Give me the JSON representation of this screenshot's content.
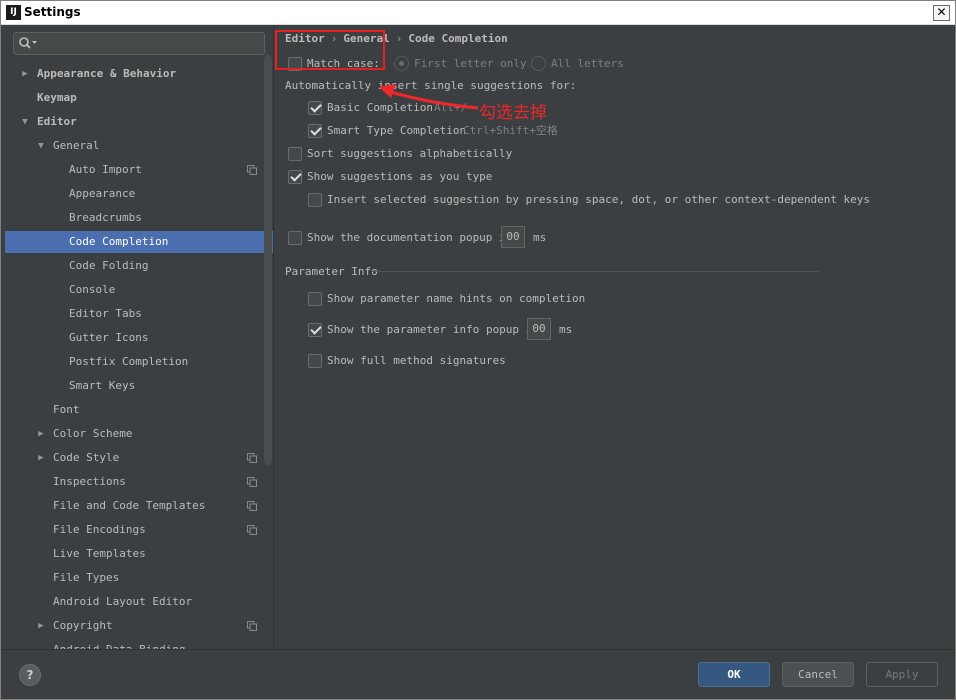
{
  "window": {
    "title": "Settings",
    "app_icon_label": "IJ",
    "close_label": "✕"
  },
  "search": {
    "value": "",
    "placeholder": ""
  },
  "tree": [
    {
      "label": "Appearance & Behavior",
      "level": 0,
      "arrow": "▶",
      "bold": true,
      "selected": false,
      "copy": false
    },
    {
      "label": "Keymap",
      "level": 0,
      "arrow": "",
      "bold": true,
      "selected": false,
      "copy": false
    },
    {
      "label": "Editor",
      "level": 0,
      "arrow": "▼",
      "bold": true,
      "selected": false,
      "copy": false
    },
    {
      "label": "General",
      "level": 1,
      "arrow": "▼",
      "bold": false,
      "selected": false,
      "copy": false
    },
    {
      "label": "Auto Import",
      "level": 2,
      "arrow": "",
      "bold": false,
      "selected": false,
      "copy": true
    },
    {
      "label": "Appearance",
      "level": 2,
      "arrow": "",
      "bold": false,
      "selected": false,
      "copy": false
    },
    {
      "label": "Breadcrumbs",
      "level": 2,
      "arrow": "",
      "bold": false,
      "selected": false,
      "copy": false
    },
    {
      "label": "Code Completion",
      "level": 2,
      "arrow": "",
      "bold": false,
      "selected": true,
      "copy": false
    },
    {
      "label": "Code Folding",
      "level": 2,
      "arrow": "",
      "bold": false,
      "selected": false,
      "copy": false
    },
    {
      "label": "Console",
      "level": 2,
      "arrow": "",
      "bold": false,
      "selected": false,
      "copy": false
    },
    {
      "label": "Editor Tabs",
      "level": 2,
      "arrow": "",
      "bold": false,
      "selected": false,
      "copy": false
    },
    {
      "label": "Gutter Icons",
      "level": 2,
      "arrow": "",
      "bold": false,
      "selected": false,
      "copy": false
    },
    {
      "label": "Postfix Completion",
      "level": 2,
      "arrow": "",
      "bold": false,
      "selected": false,
      "copy": false
    },
    {
      "label": "Smart Keys",
      "level": 2,
      "arrow": "",
      "bold": false,
      "selected": false,
      "copy": false
    },
    {
      "label": "Font",
      "level": 1,
      "arrow": "",
      "bold": false,
      "selected": false,
      "copy": false
    },
    {
      "label": "Color Scheme",
      "level": 1,
      "arrow": "▶",
      "bold": false,
      "selected": false,
      "copy": false
    },
    {
      "label": "Code Style",
      "level": 1,
      "arrow": "▶",
      "bold": false,
      "selected": false,
      "copy": true
    },
    {
      "label": "Inspections",
      "level": 1,
      "arrow": "",
      "bold": false,
      "selected": false,
      "copy": true
    },
    {
      "label": "File and Code Templates",
      "level": 1,
      "arrow": "",
      "bold": false,
      "selected": false,
      "copy": true
    },
    {
      "label": "File Encodings",
      "level": 1,
      "arrow": "",
      "bold": false,
      "selected": false,
      "copy": true
    },
    {
      "label": "Live Templates",
      "level": 1,
      "arrow": "",
      "bold": false,
      "selected": false,
      "copy": false
    },
    {
      "label": "File Types",
      "level": 1,
      "arrow": "",
      "bold": false,
      "selected": false,
      "copy": false
    },
    {
      "label": "Android Layout Editor",
      "level": 1,
      "arrow": "",
      "bold": false,
      "selected": false,
      "copy": false
    },
    {
      "label": "Copyright",
      "level": 1,
      "arrow": "▶",
      "bold": false,
      "selected": false,
      "copy": true
    },
    {
      "label": "Android Data Binding",
      "level": 1,
      "arrow": "",
      "bold": false,
      "selected": false,
      "copy": false
    }
  ],
  "breadcrumb": {
    "part1": "Editor",
    "part2": "General",
    "part3": "Code Completion",
    "separator": "›"
  },
  "options": {
    "match_case": {
      "label": "Match case:",
      "checked": false
    },
    "first_letter_only": {
      "label": "First letter only",
      "selected": true
    },
    "all_letters": {
      "label": "All letters",
      "selected": false
    },
    "auto_insert_heading": "Automatically insert single suggestions for:",
    "basic_completion": {
      "label": "Basic Completion",
      "shortcut": "Alt+/",
      "checked": true
    },
    "smart_type_completion": {
      "label": "Smart Type Completion",
      "shortcut": "Ctrl+Shift+空格",
      "checked": true
    },
    "sort_alpha": {
      "label": "Sort suggestions alphabetically",
      "checked": false
    },
    "show_as_type": {
      "label": "Show suggestions as you type",
      "checked": true
    },
    "insert_selected": {
      "label": "Insert selected suggestion by pressing space, dot, or other context-dependent keys",
      "checked": false
    },
    "doc_popup": {
      "label": "Show the documentation popup in",
      "value": "00",
      "unit": "ms",
      "checked": false
    }
  },
  "parameter_info": {
    "heading": "Parameter Info",
    "name_hints": {
      "label": "Show parameter name hints on completion",
      "checked": false
    },
    "info_popup": {
      "label": "Show the parameter info popup in",
      "value": "00",
      "unit": "ms",
      "checked": true
    },
    "full_signatures": {
      "label": "Show full method signatures",
      "checked": false
    }
  },
  "annotation": {
    "text": "勾选去掉",
    "color": "#f0272a"
  },
  "buttons": {
    "help": "?",
    "ok": "OK",
    "cancel": "Cancel",
    "apply": "Apply"
  }
}
